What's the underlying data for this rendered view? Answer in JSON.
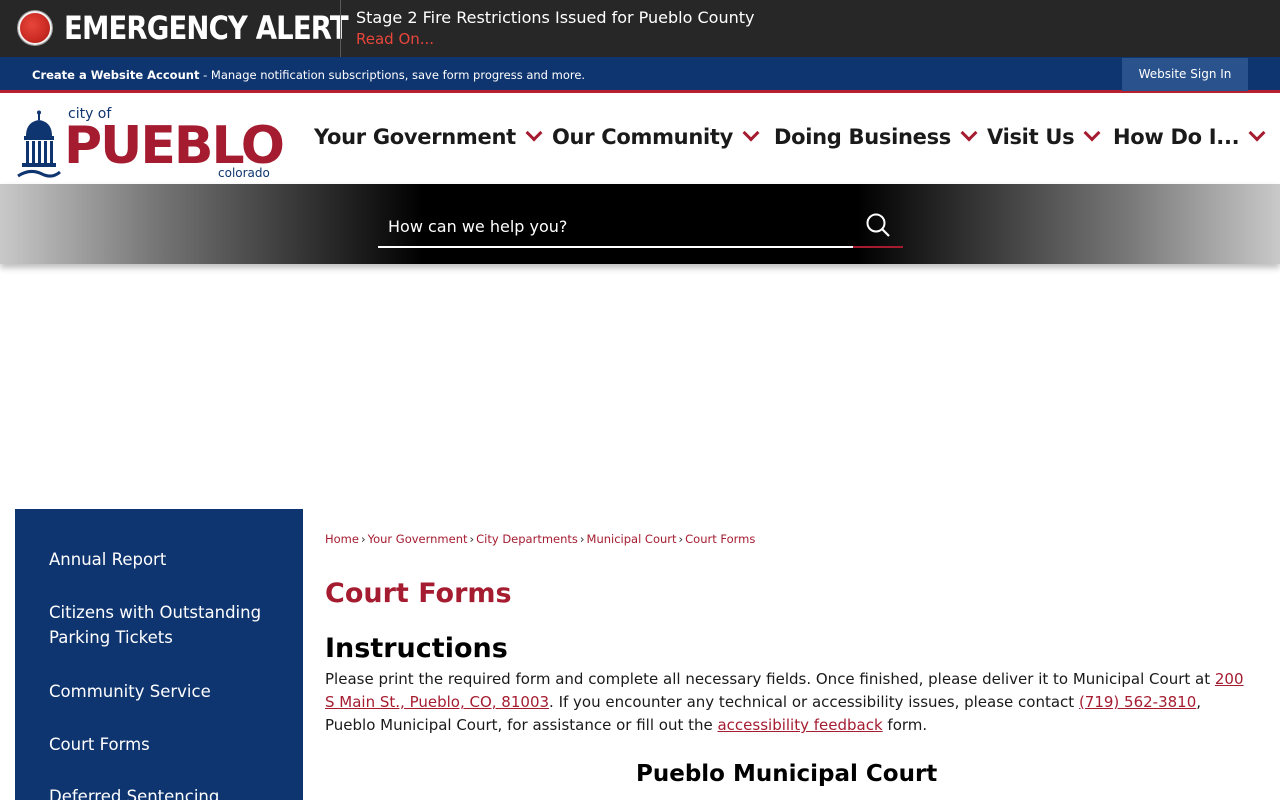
{
  "alert": {
    "title": "EMERGENCY ALERT",
    "headline": "Stage 2 Fire Restrictions Issued for Pueblo County",
    "read_on": "Read On..."
  },
  "account_bar": {
    "create_link": "Create a Website Account",
    "description": " - Manage notification subscriptions, save form progress and more.",
    "sign_in": "Website Sign In"
  },
  "logo": {
    "city_of": "city of",
    "name": "PUEBLO",
    "state": "colorado"
  },
  "nav": {
    "items": [
      {
        "label": "Your Government"
      },
      {
        "label": "Our Community"
      },
      {
        "label": "Doing Business"
      },
      {
        "label": "Visit Us"
      },
      {
        "label": "How Do I..."
      }
    ]
  },
  "search": {
    "placeholder": "How can we help you?"
  },
  "sidebar": {
    "items": [
      {
        "label": "Annual Report"
      },
      {
        "label": "Citizens with Outstanding Parking Tickets"
      },
      {
        "label": "Community Service"
      },
      {
        "label": "Court Forms"
      },
      {
        "label": "Deferred Sentencing"
      }
    ]
  },
  "breadcrumb": {
    "items": [
      {
        "label": "Home"
      },
      {
        "label": "Your Government"
      },
      {
        "label": "City Departments"
      },
      {
        "label": "Municipal Court"
      },
      {
        "label": "Court Forms"
      }
    ],
    "separator": "›"
  },
  "main": {
    "title": "Court Forms",
    "instructions_heading": "Instructions",
    "instructions": {
      "text_1": "Please print the required form and complete all necessary fields. Once finished, please deliver it to Municipal Court at ",
      "address_link": "200 S Main St., Pueblo, CO, 81003",
      "text_2": ". If you encounter any technical or accessibility issues, please contact ",
      "phone_link": "(719) 562-3810",
      "text_3": ", Pueblo Municipal Court, for assistance or fill out the ",
      "feedback_link": "accessibility feedback",
      "text_4": " form."
    },
    "court_heading": "Pueblo Municipal Court"
  },
  "colors": {
    "brand_red": "#a51c30",
    "brand_blue": "#0f3570",
    "alert_bg": "#272727"
  }
}
